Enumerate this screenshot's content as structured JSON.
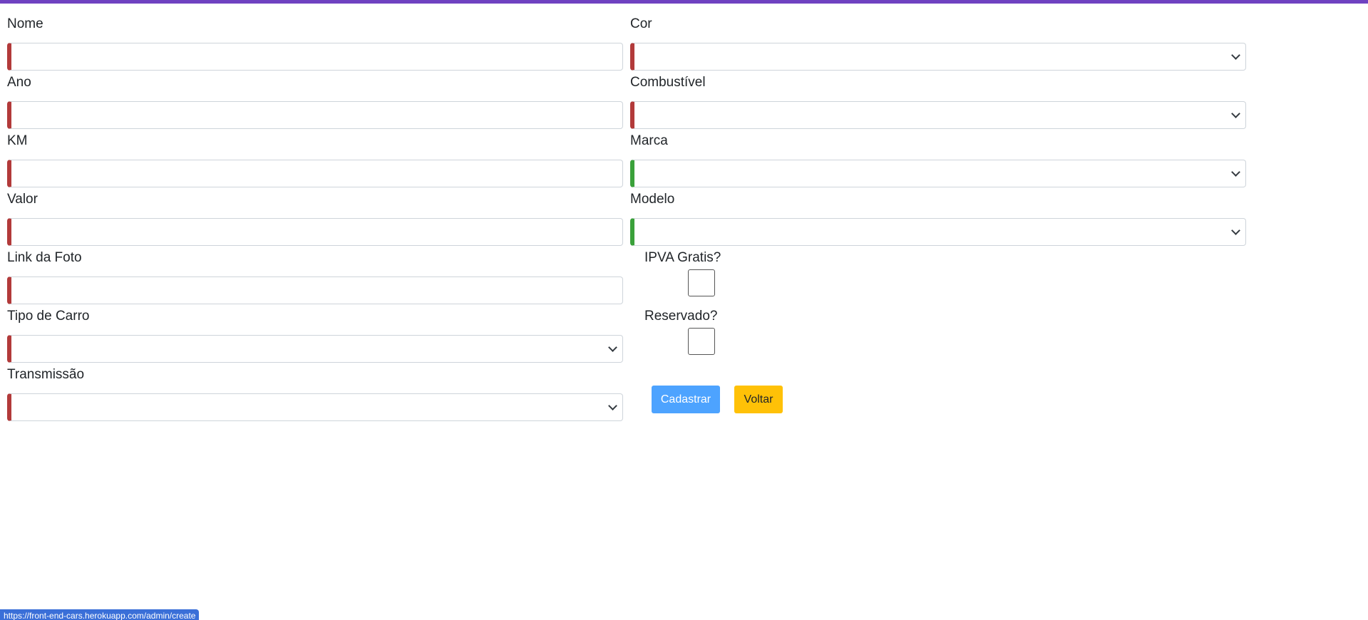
{
  "colors": {
    "top_bar": "#6f42c1",
    "invalid": "#b23a3a",
    "valid": "#3aa13a",
    "primary_button": "#4da3ff",
    "warning_button": "#ffc107",
    "status_bar": "#3a6fd8"
  },
  "form": {
    "nome": {
      "label": "Nome",
      "value": ""
    },
    "ano": {
      "label": "Ano",
      "value": ""
    },
    "km": {
      "label": "KM",
      "value": ""
    },
    "valor": {
      "label": "Valor",
      "value": ""
    },
    "link_foto": {
      "label": "Link da Foto",
      "value": ""
    },
    "tipo_carro": {
      "label": "Tipo de Carro",
      "selected": ""
    },
    "transmissao": {
      "label": "Transmissão",
      "selected": ""
    },
    "cor": {
      "label": "Cor",
      "selected": ""
    },
    "combustivel": {
      "label": "Combustível",
      "selected": ""
    },
    "marca": {
      "label": "Marca",
      "selected": ""
    },
    "modelo": {
      "label": "Modelo",
      "selected": ""
    },
    "ipva_gratis": {
      "label": "IPVA Gratis?",
      "checked": false
    },
    "reservado": {
      "label": "Reservado?",
      "checked": false
    }
  },
  "buttons": {
    "cadastrar": "Cadastrar",
    "voltar": "Voltar"
  },
  "status_bar": {
    "url": "https://front-end-cars.herokuapp.com/admin/create"
  }
}
